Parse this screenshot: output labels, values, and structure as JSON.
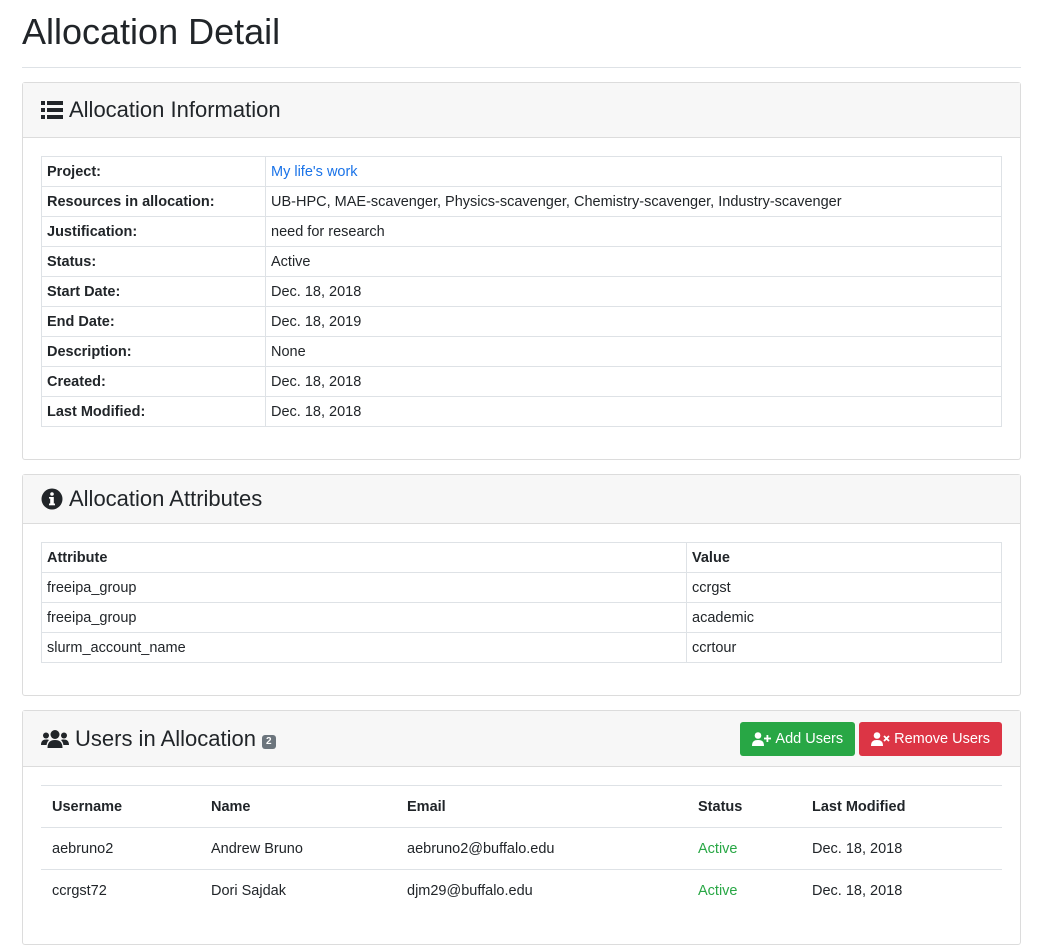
{
  "page": {
    "title": "Allocation Detail"
  },
  "allocation_info": {
    "title": "Allocation Information",
    "rows": [
      {
        "label": "Project:",
        "value": "My life's work"
      },
      {
        "label": "Resources in allocation:",
        "value": "UB-HPC, MAE-scavenger, Physics-scavenger, Chemistry-scavenger, Industry-scavenger"
      },
      {
        "label": "Justification:",
        "value": "need for research"
      },
      {
        "label": "Status:",
        "value": "Active"
      },
      {
        "label": "Start Date:",
        "value": "Dec. 18, 2018"
      },
      {
        "label": "End Date:",
        "value": "Dec. 18, 2019"
      },
      {
        "label": "Description:",
        "value": "None"
      },
      {
        "label": "Created:",
        "value": "Dec. 18, 2018"
      },
      {
        "label": "Last Modified:",
        "value": "Dec. 18, 2018"
      }
    ]
  },
  "allocation_attributes": {
    "title": "Allocation Attributes",
    "headers": [
      "Attribute",
      "Value"
    ],
    "rows": [
      {
        "attribute": "freeipa_group",
        "value": "ccrgst"
      },
      {
        "attribute": "freeipa_group",
        "value": "academic"
      },
      {
        "attribute": "slurm_account_name",
        "value": "ccrtour"
      }
    ]
  },
  "users": {
    "title": "Users in Allocation",
    "count": "2",
    "add_label": "Add Users",
    "remove_label": "Remove Users",
    "headers": [
      "Username",
      "Name",
      "Email",
      "Status",
      "Last Modified"
    ],
    "rows": [
      {
        "username": "aebruno2",
        "name": "Andrew Bruno",
        "email": "aebruno2@buffalo.edu",
        "status": "Active",
        "last_modified": "Dec. 18, 2018"
      },
      {
        "username": "ccrgst72",
        "name": "Dori Sajdak",
        "email": "djm29@buffalo.edu",
        "status": "Active",
        "last_modified": "Dec. 18, 2018"
      }
    ]
  },
  "colors": {
    "link": "#1a73e8",
    "success": "#28a745",
    "danger": "#dc3545",
    "badge": "#6c757d",
    "header_bg": "#f7f7f7"
  },
  "icons": {
    "info_card": "list-icon",
    "attributes_card": "info-circle-icon",
    "users_card": "users-icon",
    "add": "user-plus-icon",
    "remove": "user-times-icon"
  }
}
